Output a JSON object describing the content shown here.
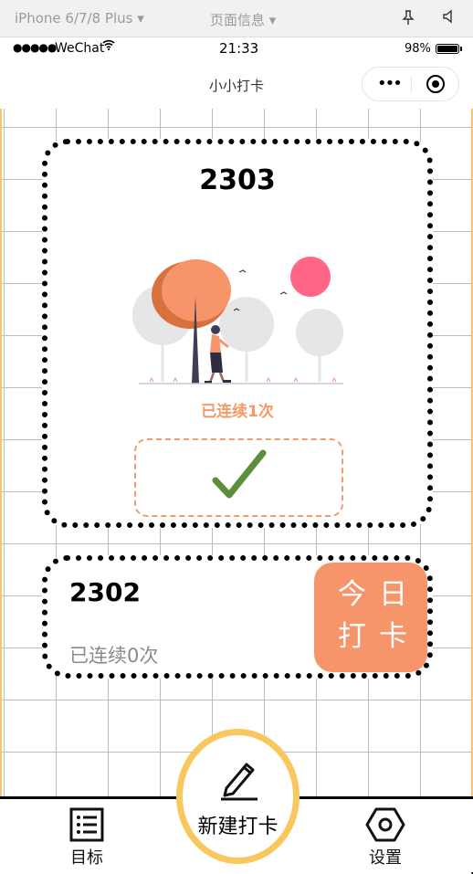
{
  "simulator": {
    "device": "iPhone 6/7/8 Plus ▾",
    "page_info": "页面信息 ▾"
  },
  "status_bar": {
    "carrier": "WeChat",
    "time": "21:33",
    "battery": "98%",
    "battery_level": 0.98
  },
  "nav": {
    "title": "小小打卡",
    "more": "•••"
  },
  "cards": [
    {
      "title": "2303",
      "streak": "已连续1次",
      "checked": true
    },
    {
      "title": "2302",
      "streak": "已连续0次",
      "checkin_button": "今日打卡"
    }
  ],
  "tabbar": {
    "goal_label": "目标",
    "new_label": "新建打卡",
    "settings_label": "设置"
  },
  "colors": {
    "accent": "#f6946a",
    "fab_ring": "#f8c85e",
    "check": "#5b8f3c"
  }
}
